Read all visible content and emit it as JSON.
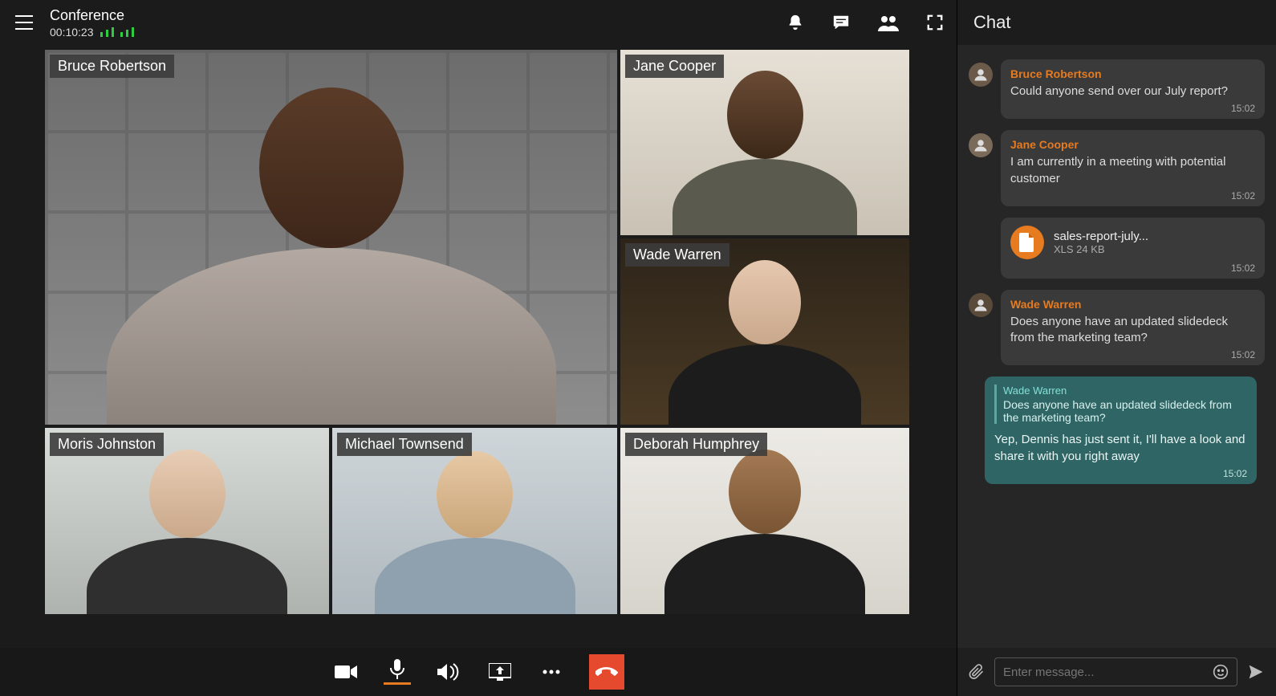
{
  "header": {
    "title": "Conference",
    "timer": "00:10:23"
  },
  "participants": [
    {
      "name": "Bruce Robertson",
      "active": true
    },
    {
      "name": "Jane Cooper",
      "active": false
    },
    {
      "name": "Wade Warren",
      "active": false
    },
    {
      "name": "Moris Johnston",
      "active": false
    },
    {
      "name": "Michael Townsend",
      "active": false
    },
    {
      "name": "Deborah Humphrey",
      "active": false
    }
  ],
  "chat": {
    "title": "Chat",
    "input_placeholder": "Enter message...",
    "messages": [
      {
        "type": "text",
        "name": "Bruce Robertson",
        "text": "Could anyone send over our July report?",
        "time": "15:02"
      },
      {
        "type": "text",
        "name": "Jane Cooper",
        "text": " I am currently in a meeting with potential customer",
        "time": "15:02"
      },
      {
        "type": "file",
        "file_name": "sales-report-july...",
        "file_meta": "XLS 24 KB",
        "time": "15:02"
      },
      {
        "type": "text",
        "name": "Wade Warren",
        "text": "Does anyone have an updated slidedeck\nfrom the marketing team?",
        "time": "15:02"
      },
      {
        "type": "quote",
        "quote_name": "Wade Warren",
        "quote_text": "Does anyone have an updated slidedeck from the marketing team?",
        "text": "Yep, Dennis has just sent it, I'll have a look and share it with you right away",
        "time": "15:02"
      }
    ]
  },
  "colors": {
    "accent": "#e67b1f",
    "hangup": "#e64a2e",
    "quote_bg": "#2f6565",
    "signal": "#2ecc40"
  }
}
